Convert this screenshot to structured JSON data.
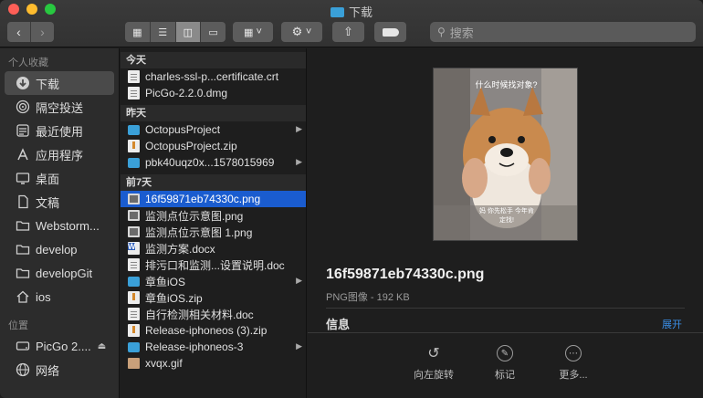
{
  "window": {
    "title": "下载"
  },
  "toolbar": {
    "back_icon": "chevron-left-icon",
    "forward_icon": "chevron-right-icon",
    "view_modes": [
      "icon-view-icon",
      "list-view-icon",
      "column-view-icon",
      "gallery-view-icon"
    ],
    "active_view": "column-view-icon",
    "search_placeholder": "搜索"
  },
  "sidebar": {
    "favorites_heading": "个人收藏",
    "favorites": [
      {
        "label": "下载",
        "icon": "download-icon",
        "selected": true
      },
      {
        "label": "隔空投送",
        "icon": "airdrop-icon"
      },
      {
        "label": "最近使用",
        "icon": "recents-icon"
      },
      {
        "label": "应用程序",
        "icon": "applications-icon"
      },
      {
        "label": "桌面",
        "icon": "desktop-icon"
      },
      {
        "label": "文稿",
        "icon": "documents-icon"
      },
      {
        "label": "Webstorm...",
        "icon": "folder-icon"
      },
      {
        "label": "develop",
        "icon": "folder-icon"
      },
      {
        "label": "developGit",
        "icon": "folder-icon"
      },
      {
        "label": "ios",
        "icon": "home-icon"
      }
    ],
    "locations_heading": "位置",
    "locations": [
      {
        "label": "PicGo 2....",
        "icon": "disk-icon"
      },
      {
        "label": "网络",
        "icon": "network-icon"
      }
    ]
  },
  "column1": {
    "groups": [
      {
        "heading": "今天",
        "items": [
          {
            "name": "charles-ssl-p...certificate.crt",
            "kind": "doc"
          },
          {
            "name": "PicGo-2.2.0.dmg",
            "kind": "doc"
          }
        ]
      },
      {
        "heading": "昨天",
        "items": [
          {
            "name": "OctopusProject",
            "kind": "folder"
          },
          {
            "name": "OctopusProject.zip",
            "kind": "zip"
          },
          {
            "name": "pbk40uqz0x...1578015969",
            "kind": "folder"
          }
        ]
      },
      {
        "heading": "前7天",
        "items": [
          {
            "name": "16f59871eb74330c.png",
            "kind": "img",
            "selected": true
          },
          {
            "name": "监测点位示意图.png",
            "kind": "img"
          },
          {
            "name": "监测点位示意图 1.png",
            "kind": "img"
          },
          {
            "name": "监测方案.docx",
            "kind": "word"
          },
          {
            "name": "排污口和监测...设置说明.doc",
            "kind": "doc"
          },
          {
            "name": "章鱼iOS",
            "kind": "folder"
          },
          {
            "name": "章鱼iOS.zip",
            "kind": "zip"
          },
          {
            "name": "自行检测相关材料.doc",
            "kind": "doc"
          },
          {
            "name": "Release-iphoneos (3).zip",
            "kind": "zip"
          },
          {
            "name": "Release-iphoneos-3",
            "kind": "folder"
          },
          {
            "name": "xvqx.gif",
            "kind": "gif"
          }
        ]
      }
    ]
  },
  "preview": {
    "image_caption": "什么时候找对象?",
    "image_subcaption": "妈 你先松手 今年肯定找!",
    "file_name": "16f59871eb74330c.png",
    "file_meta": "PNG图像 - 192 KB",
    "info_label": "信息",
    "expand_label": "展开",
    "actions": [
      {
        "label": "向左旋转",
        "icon": "rotate-left-icon"
      },
      {
        "label": "标记",
        "icon": "markup-icon"
      },
      {
        "label": "更多...",
        "icon": "more-icon"
      }
    ]
  }
}
